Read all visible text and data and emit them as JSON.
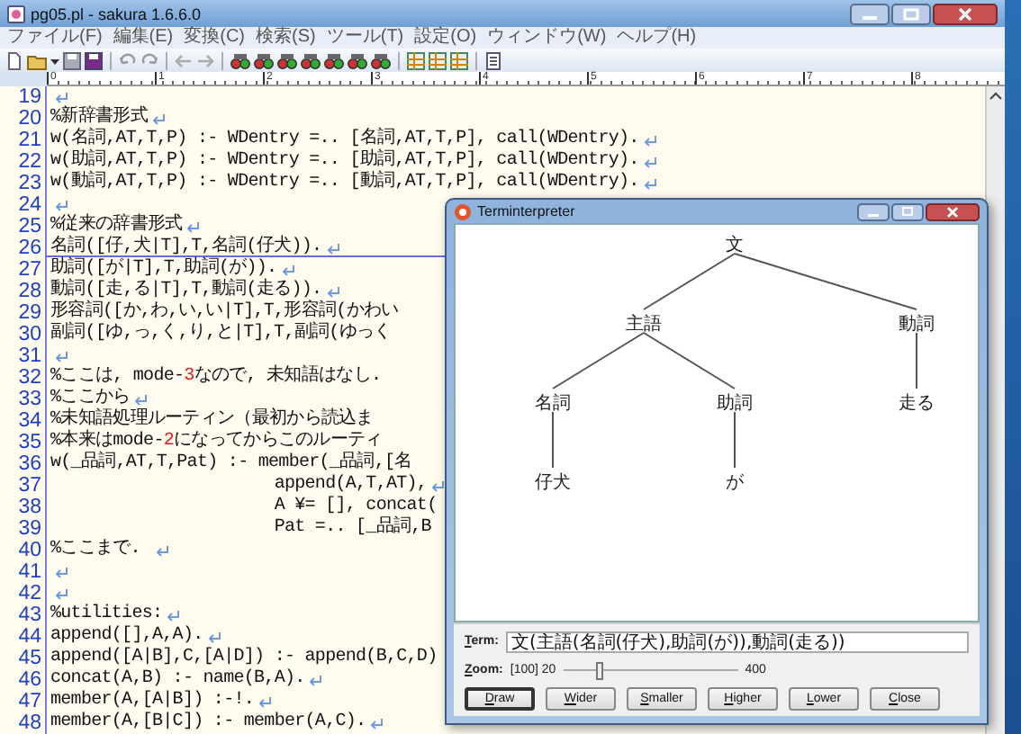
{
  "editor": {
    "title": "pg05.pl - sakura 1.6.6.0",
    "menu": [
      "ファイル(F)",
      "編集(E)",
      "変換(C)",
      "検索(S)",
      "ツール(T)",
      "設定(O)",
      "ウィンドウ(W)",
      "ヘルプ(H)"
    ],
    "ruler": [
      "0",
      "1",
      "2",
      "3",
      "4",
      "5",
      "6",
      "7",
      "8"
    ],
    "lines": [
      {
        "number": "19",
        "eol": true,
        "current": false
      },
      {
        "number": "20",
        "text": "%新辞書形式",
        "eol": true,
        "current": false
      },
      {
        "number": "21",
        "text": "w(名詞,AT,T,P) :- WDentry =.. [名詞,AT,T,P], call(WDentry).",
        "eol": true,
        "current": false
      },
      {
        "number": "22",
        "text": "w(助詞,AT,T,P) :- WDentry =.. [助詞,AT,T,P], call(WDentry).",
        "eol": true,
        "current": false
      },
      {
        "number": "23",
        "text": "w(動詞,AT,T,P) :- WDentry =.. [動詞,AT,T,P], call(WDentry).",
        "eol": true,
        "current": false
      },
      {
        "number": "24",
        "eol": true,
        "current": false
      },
      {
        "number": "25",
        "text": "%従来の辞書形式",
        "eol": true,
        "current": false
      },
      {
        "number": "26",
        "text": "名詞([仔,犬|T],T,名詞(仔犬)).",
        "eol": true,
        "current": true
      },
      {
        "number": "27",
        "text": "助詞([が|T],T,助詞(が)).",
        "eol": true,
        "current": false
      },
      {
        "number": "28",
        "text": "動詞([走,る|T],T,動詞(走る)).",
        "eol": true,
        "current": false
      },
      {
        "number": "29",
        "text": "形容詞([か,わ,い,い|T],T,形容詞(かわい",
        "eol": false,
        "current": false
      },
      {
        "number": "30",
        "text": "副詞([ゆ,っ,く,り,と|T],T,副詞(ゆっく",
        "eol": false,
        "current": false
      },
      {
        "number": "31",
        "eol": true,
        "current": false
      },
      {
        "number": "32",
        "parts": [
          {
            "text": "%ここは, mode-",
            "kind": "code"
          },
          {
            "text": "3",
            "kind": "number"
          },
          {
            "text": "なので, 未知語はなし.",
            "kind": "code"
          }
        ],
        "eol": false,
        "current": false
      },
      {
        "number": "33",
        "text": "%ここから",
        "eol": true,
        "current": false
      },
      {
        "number": "34",
        "text": "%未知語処理ルーティン（最初から読込ま",
        "eol": false,
        "current": false
      },
      {
        "number": "35",
        "parts": [
          {
            "text": "%本来はmode-",
            "kind": "code"
          },
          {
            "text": "2",
            "kind": "number"
          },
          {
            "text": "になってからこのルーティ",
            "kind": "code"
          }
        ],
        "eol": false,
        "current": false
      },
      {
        "number": "36",
        "text": "w(_品詞,AT,T,Pat) :- member(_品詞,[名",
        "eol": false,
        "current": false
      },
      {
        "number": "37",
        "text": "                      append(A,T,AT),",
        "eol": true,
        "current": false
      },
      {
        "number": "38",
        "text": "                      A ¥= [], concat(",
        "eol": false,
        "current": false
      },
      {
        "number": "39",
        "text": "                      Pat =.. [_品詞,B",
        "eol": false,
        "current": false
      },
      {
        "number": "40",
        "text": "%ここまで. ",
        "eol": true,
        "current": false
      },
      {
        "number": "41",
        "eol": true,
        "current": false
      },
      {
        "number": "42",
        "eol": true,
        "current": false
      },
      {
        "number": "43",
        "text": "%utilities:",
        "eol": true,
        "current": false
      },
      {
        "number": "44",
        "text": "append([],A,A).",
        "eol": true,
        "current": false
      },
      {
        "number": "45",
        "text": "append([A|B],C,[A|D]) :- append(B,C,D)",
        "eol": false,
        "current": false
      },
      {
        "number": "46",
        "text": "concat(A,B) :- name(B,A).",
        "eol": true,
        "current": false
      },
      {
        "number": "47",
        "text": "member(A,[A|B]) :-!.",
        "eol": true,
        "current": false
      },
      {
        "number": "48",
        "text": "member(A,[B|C]) :- member(A,C).",
        "eol": true,
        "current": false
      }
    ]
  },
  "dialog": {
    "title": "Terminterpreter",
    "tree": {
      "label": "文",
      "children": [
        {
          "label": "主語",
          "children": [
            {
              "label": "名詞",
              "children": [
                {
                  "label": "仔犬"
                }
              ]
            },
            {
              "label": "助詞",
              "children": [
                {
                  "label": "が"
                }
              ]
            }
          ]
        },
        {
          "label": "動詞",
          "children": [
            {
              "label": "走る"
            }
          ]
        }
      ]
    },
    "term_label": "Term:",
    "term_value": "文(主語(名詞(仔犬),助詞(が)),動詞(走る))",
    "zoom_label": "Zoom:",
    "zoom_value": "[100] 20",
    "zoom_max": "400",
    "zoom_slider": {
      "level": 0.21
    },
    "buttons": [
      {
        "label": "Draw",
        "default": true
      },
      {
        "label": "Wider",
        "default": false
      },
      {
        "label": "Smaller",
        "default": false
      },
      {
        "label": "Higher",
        "default": false
      },
      {
        "label": "Lower",
        "default": false
      },
      {
        "label": "Close",
        "default": false
      }
    ]
  }
}
